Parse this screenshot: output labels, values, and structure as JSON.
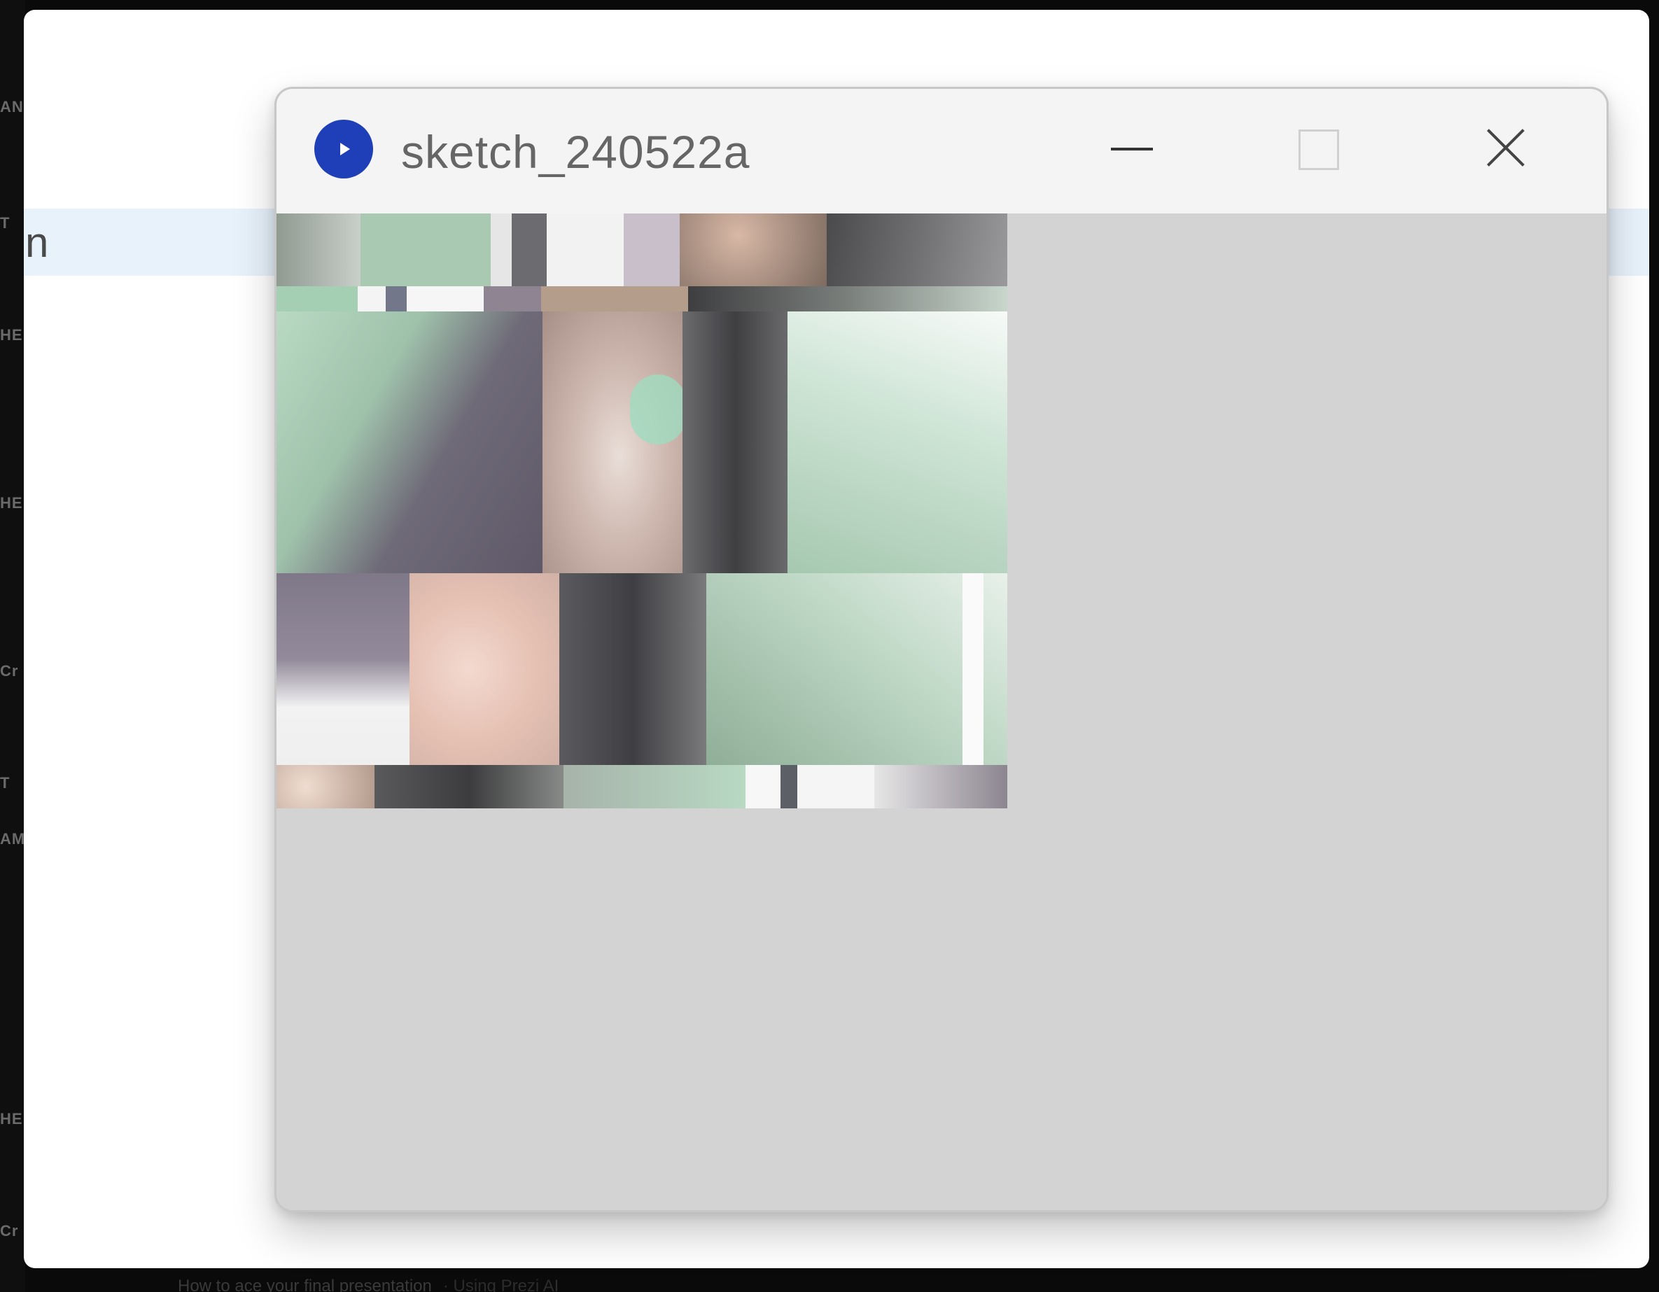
{
  "background": {
    "left_strip_fragments": [
      "AN",
      "T",
      "HE",
      "HE",
      "Cr",
      "T",
      "AM",
      "HE",
      "Cr"
    ],
    "highlight_glyph": "n",
    "bottom_caption": "How to ace your final presentation",
    "bottom_caption_sub": "· Using Prezi AI"
  },
  "window": {
    "title": "sketch_240522a",
    "app_icon": "processing-play-icon",
    "controls": {
      "minimize_icon": "minimize-icon",
      "maximize_icon": "maximize-icon",
      "close_icon": "close-icon"
    },
    "canvas_background": "#d3d3d3"
  },
  "colors": {
    "titlebar": "#f4f4f4",
    "app_icon": "#1f3fb8",
    "canvas": "#d3d3d3",
    "highlight_row": "#e8f2fb"
  }
}
